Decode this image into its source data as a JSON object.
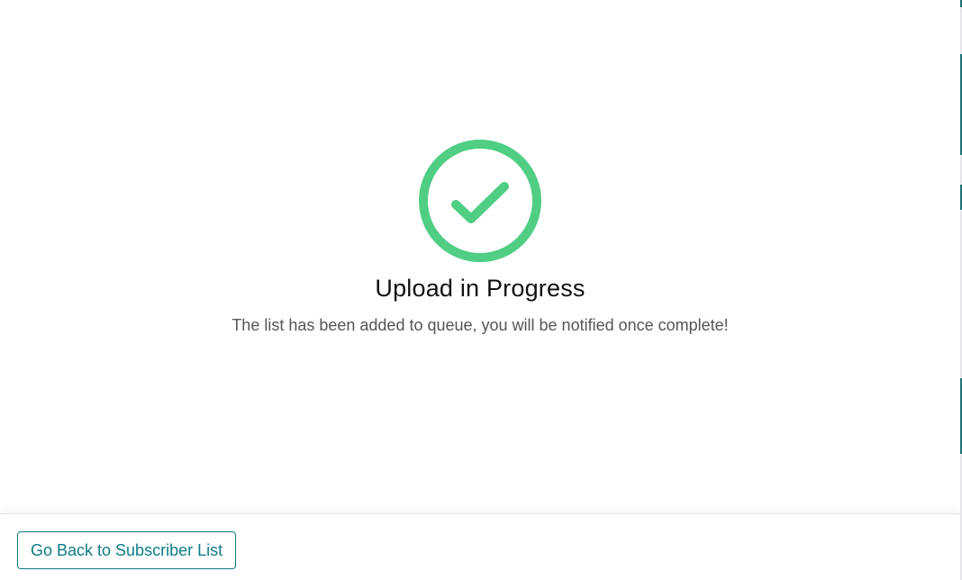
{
  "status": {
    "icon": "check-circle-icon",
    "title": "Upload in Progress",
    "message": "The list has been added to queue, you will be notified once complete!",
    "accent_color": "#4fce84"
  },
  "footer": {
    "back_button_label": "Go Back to Subscriber List",
    "button_color": "#0e7c86"
  }
}
